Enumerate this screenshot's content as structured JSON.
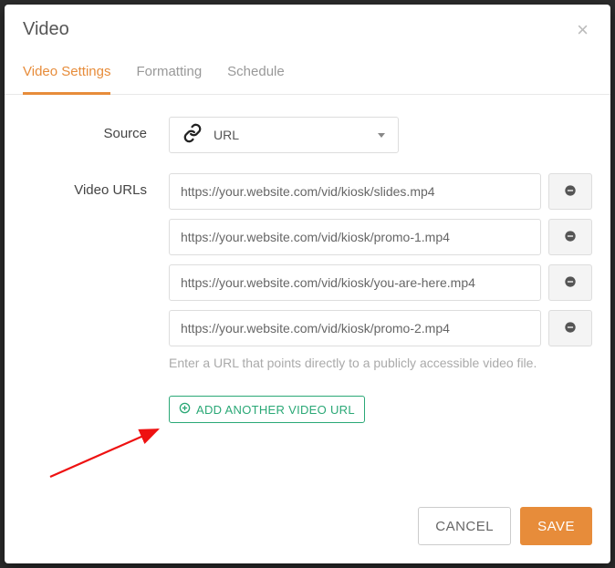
{
  "modal": {
    "title": "Video",
    "tabs": [
      {
        "label": "Video Settings",
        "active": true
      },
      {
        "label": "Formatting",
        "active": false
      },
      {
        "label": "Schedule",
        "active": false
      }
    ],
    "source": {
      "label": "Source",
      "value": "URL"
    },
    "urls": {
      "label": "Video URLs",
      "items": [
        "https://your.website.com/vid/kiosk/slides.mp4",
        "https://your.website.com/vid/kiosk/promo-1.mp4",
        "https://your.website.com/vid/kiosk/you-are-here.mp4",
        "https://your.website.com/vid/kiosk/promo-2.mp4"
      ],
      "help": "Enter a URL that points directly to a publicly accessible video file."
    },
    "add_button": "ADD ANOTHER VIDEO URL",
    "footer": {
      "cancel": "CANCEL",
      "save": "SAVE"
    }
  }
}
